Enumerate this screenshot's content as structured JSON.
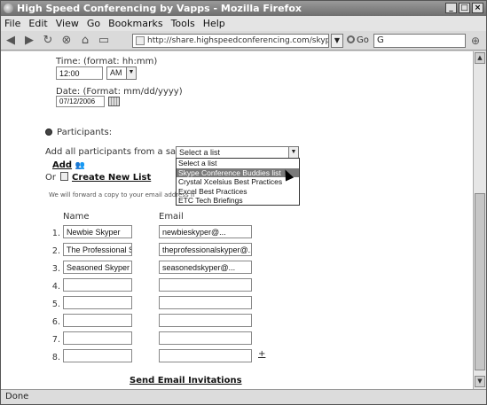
{
  "window": {
    "title": "High Speed Conferencing by Vapps - Mozilla Firefox",
    "controls": [
      "_",
      "□",
      "×"
    ]
  },
  "menu": [
    {
      "label": "File"
    },
    {
      "label": "Edit"
    },
    {
      "label": "View"
    },
    {
      "label": "Go"
    },
    {
      "label": "Bookmarks"
    },
    {
      "label": "Tools"
    },
    {
      "label": "Help"
    }
  ],
  "nav": {
    "url": "http://share.highspeedconferencing.com/skype_new/sc",
    "go_label": "Go",
    "search_value": "G"
  },
  "form": {
    "time_label": "Time: (format: hh:mm)",
    "time_value": "12:00",
    "ampm_value": "AM",
    "date_label": "Date: (Format: mm/dd/yyyy)",
    "date_value": "07/12/2006",
    "participants_label": "Participants:",
    "saved_list_label": "Add all participants from a saved list :",
    "select_value": "Select a list",
    "add_link": "Add",
    "or_label": "Or",
    "create_list_link": "Create New List",
    "forward_note": "We will forward a copy to your email address fr",
    "name_header": "Name",
    "email_header": "Email",
    "send_link": "Send Email Invitations",
    "more_link": "+"
  },
  "dropdown_options": [
    {
      "label": "Select a list",
      "highlighted": false
    },
    {
      "label": "Skype Conference Buddies list",
      "highlighted": true
    },
    {
      "label": "Crystal Xcelsius Best Practices",
      "highlighted": false
    },
    {
      "label": "Excel Best Practices",
      "highlighted": false
    },
    {
      "label": "ETC Tech Briefings",
      "highlighted": false
    }
  ],
  "participants": [
    {
      "num": "1.",
      "name": "Newbie Skyper",
      "email": "newbieskyper@..."
    },
    {
      "num": "2.",
      "name": "The Professional Sk",
      "email": "theprofessionalskyper@..."
    },
    {
      "num": "3.",
      "name": "Seasoned Skyper",
      "email": "seasonedskyper@..."
    },
    {
      "num": "4.",
      "name": "",
      "email": ""
    },
    {
      "num": "5.",
      "name": "",
      "email": ""
    },
    {
      "num": "6.",
      "name": "",
      "email": ""
    },
    {
      "num": "7.",
      "name": "",
      "email": ""
    },
    {
      "num": "8.",
      "name": "",
      "email": ""
    }
  ],
  "status": {
    "text": "Done"
  }
}
